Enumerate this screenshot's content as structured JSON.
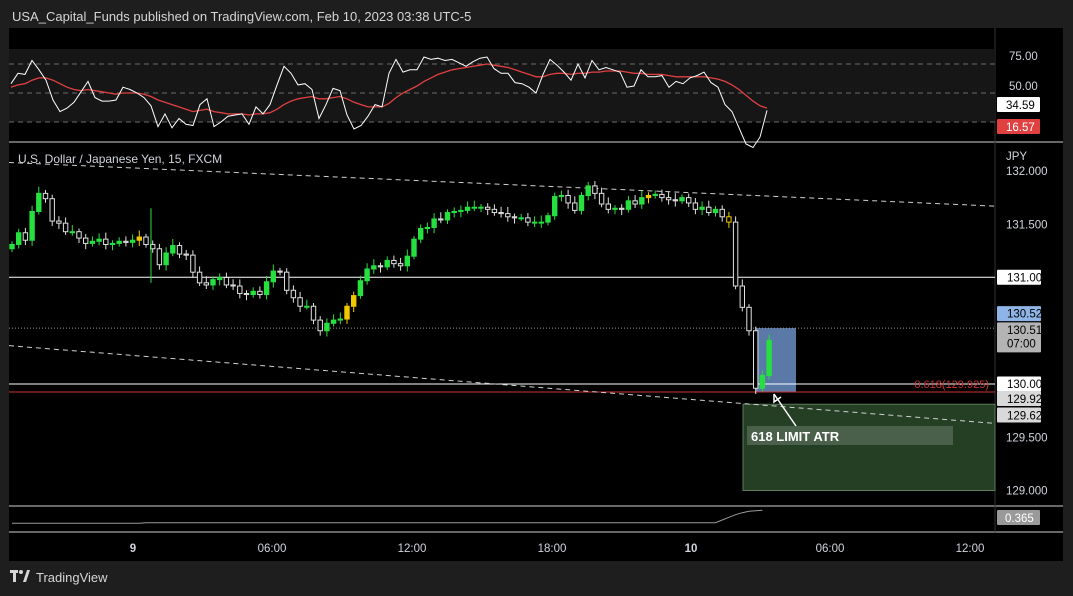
{
  "header": {
    "text": "USA_Capital_Funds published on TradingView.com, Feb 10, 2023 03:38 UTC-5"
  },
  "footer": {
    "brand": "TradingView",
    "logo": "tradingview-logo-icon"
  },
  "colors": {
    "background": "#000000",
    "bull": "#26e040",
    "bear": "#e0e0e0",
    "yellow": "#f0c800",
    "rsi_line": "#ffffff",
    "rsi_ma": "#e04040",
    "fib": "#cc3333",
    "target_zone": "#2c4a2c",
    "entry_zone": "#6a8ec4"
  },
  "chart_data": [
    {
      "type": "line",
      "pane": "RSI",
      "yticks": [
        "75.00",
        "50.00"
      ],
      "ylim": [
        0,
        100
      ],
      "levels": [
        75,
        50,
        25
      ],
      "rsi_value": "34.59",
      "ma_value": "16.57",
      "series": [
        {
          "values": [
            58,
            67,
            66,
            78,
            70,
            61,
            44,
            34,
            37,
            42,
            51,
            60,
            46,
            43,
            43,
            44,
            55,
            53,
            50,
            46,
            39,
            21,
            32,
            20,
            28,
            23,
            22,
            40,
            45,
            21,
            25,
            30,
            31,
            32,
            23,
            38,
            32,
            40,
            57,
            73,
            67,
            57,
            58,
            53,
            28,
            40,
            54,
            52,
            31,
            19,
            22,
            30,
            40,
            38,
            67,
            79,
            68,
            70,
            70,
            81,
            79,
            80,
            78,
            79,
            76,
            73,
            77,
            80,
            81,
            71,
            67,
            67,
            59,
            58,
            55,
            50,
            66,
            79,
            74,
            68,
            61,
            75,
            63,
            78,
            70,
            72,
            70,
            68,
            55,
            56,
            70,
            64,
            64,
            65,
            55,
            60,
            58,
            63,
            65,
            68,
            59,
            55,
            40,
            34,
            20,
            6,
            3,
            12,
            35
          ]
        },
        {
          "values": [
            55,
            57,
            58,
            61,
            63,
            63,
            61,
            58,
            55,
            53,
            52,
            53,
            52,
            51,
            50,
            49,
            50,
            50,
            50,
            49,
            47,
            44,
            42,
            40,
            38,
            36,
            34,
            35,
            36,
            34,
            33,
            32,
            32,
            32,
            31,
            32,
            32,
            33,
            36,
            40,
            43,
            45,
            46,
            47,
            45,
            45,
            46,
            47,
            45,
            42,
            40,
            38,
            38,
            38,
            41,
            46,
            50,
            53,
            56,
            60,
            63,
            66,
            68,
            70,
            71,
            72,
            73,
            74,
            75,
            74,
            73,
            72,
            70,
            68,
            66,
            64,
            64,
            66,
            67,
            67,
            66,
            67,
            67,
            68,
            68,
            69,
            69,
            69,
            68,
            67,
            67,
            66,
            66,
            66,
            65,
            64,
            64,
            64,
            64,
            64,
            63,
            62,
            60,
            57,
            53,
            48,
            43,
            39,
            37
          ]
        }
      ]
    },
    {
      "type": "candlestick",
      "pane": "price",
      "symbol": "U.S. Dollar / Japanese Yen, 15, FXCM",
      "currency": "JPY",
      "yticks": [
        "132.000",
        "131.500",
        "131.002",
        "130.513",
        "130.000",
        "129.500",
        "129.000"
      ],
      "ylim": [
        128.95,
        132.15
      ],
      "xticks": [
        "9",
        "06:00",
        "12:00",
        "18:00",
        "10",
        "06:00",
        "12:00"
      ],
      "levels": {
        "horizontal_1": 131.002,
        "horizontal_2": 130.0,
        "dotted_price": 130.525
      },
      "price_labels": {
        "last_price": "130.525",
        "bid": "130.513",
        "countdown": "07:00",
        "fib_label": "0.618(129.925)",
        "fib_value": "129.925",
        "target_value": "129.625"
      },
      "trendlines": [
        {
          "start": [
            "open",
            132.08
          ],
          "end": [
            "20:30 Feb 10",
            131.67
          ],
          "style": "dashed"
        },
        {
          "start": [
            "open",
            130.36
          ],
          "end": [
            "20:30 Feb 10",
            129.63
          ],
          "style": "dashed"
        }
      ],
      "annotation": "618 LIMIT ATR",
      "zones": {
        "entry": {
          "top": 130.525,
          "bottom": 129.925
        },
        "target": {
          "top": 129.81,
          "bottom": 129.0
        }
      },
      "closes": [
        131.31,
        131.42,
        131.35,
        131.62,
        131.79,
        131.74,
        131.53,
        131.51,
        131.43,
        131.43,
        131.37,
        131.32,
        131.34,
        131.36,
        131.31,
        131.32,
        131.34,
        131.33,
        131.35,
        131.38,
        131.31,
        131.27,
        131.12,
        131.23,
        131.3,
        131.22,
        131.21,
        131.05,
        130.95,
        130.93,
        130.98,
        131.0,
        130.93,
        130.92,
        130.85,
        130.84,
        130.87,
        130.84,
        130.96,
        131.06,
        131.05,
        130.88,
        130.81,
        130.73,
        130.73,
        130.6,
        130.5,
        130.57,
        130.6,
        130.61,
        130.73,
        130.83,
        130.97,
        131.08,
        131.11,
        131.1,
        131.16,
        131.13,
        131.11,
        131.2,
        131.36,
        131.46,
        131.47,
        131.55,
        131.54,
        131.61,
        131.62,
        131.63,
        131.66,
        131.66,
        131.66,
        131.64,
        131.61,
        131.6,
        131.57,
        131.56,
        131.56,
        131.52,
        131.52,
        131.52,
        131.58,
        131.76,
        131.77,
        131.7,
        131.63,
        131.77,
        131.86,
        131.79,
        131.69,
        131.64,
        131.65,
        131.64,
        131.72,
        131.69,
        131.75,
        131.77,
        131.78,
        131.75,
        131.73,
        131.72,
        131.75,
        131.7,
        131.64,
        131.66,
        131.61,
        131.64,
        131.57,
        131.52,
        130.92,
        130.72,
        130.5,
        129.96,
        130.08,
        130.41
      ]
    },
    {
      "type": "line",
      "pane": "ATR",
      "value": "0.365",
      "series": [
        {
          "values": [
            0.17,
            0.17,
            0.17,
            0.17,
            0.17,
            0.17,
            0.17,
            0.17,
            0.17,
            0.17,
            0.17,
            0.17,
            0.17,
            0.17,
            0.17,
            0.17,
            0.17,
            0.17,
            0.17,
            0.17,
            0.18,
            0.18,
            0.18,
            0.18,
            0.18,
            0.18,
            0.18,
            0.18,
            0.18,
            0.18,
            0.18,
            0.18,
            0.18,
            0.18,
            0.18,
            0.18,
            0.18,
            0.18,
            0.18,
            0.18,
            0.18,
            0.18,
            0.18,
            0.18,
            0.18,
            0.18,
            0.18,
            0.18,
            0.18,
            0.18,
            0.18,
            0.18,
            0.18,
            0.18,
            0.18,
            0.18,
            0.18,
            0.18,
            0.18,
            0.18,
            0.18,
            0.18,
            0.18,
            0.18,
            0.18,
            0.18,
            0.18,
            0.18,
            0.18,
            0.18,
            0.18,
            0.18,
            0.18,
            0.18,
            0.18,
            0.18,
            0.18,
            0.18,
            0.18,
            0.18,
            0.18,
            0.18,
            0.18,
            0.18,
            0.18,
            0.18,
            0.18,
            0.18,
            0.18,
            0.18,
            0.18,
            0.18,
            0.18,
            0.18,
            0.18,
            0.18,
            0.18,
            0.18,
            0.18,
            0.18,
            0.18,
            0.18,
            0.18,
            0.18,
            0.18,
            0.18,
            0.22,
            0.26,
            0.3,
            0.33,
            0.35,
            0.36,
            0.365
          ]
        }
      ]
    }
  ]
}
